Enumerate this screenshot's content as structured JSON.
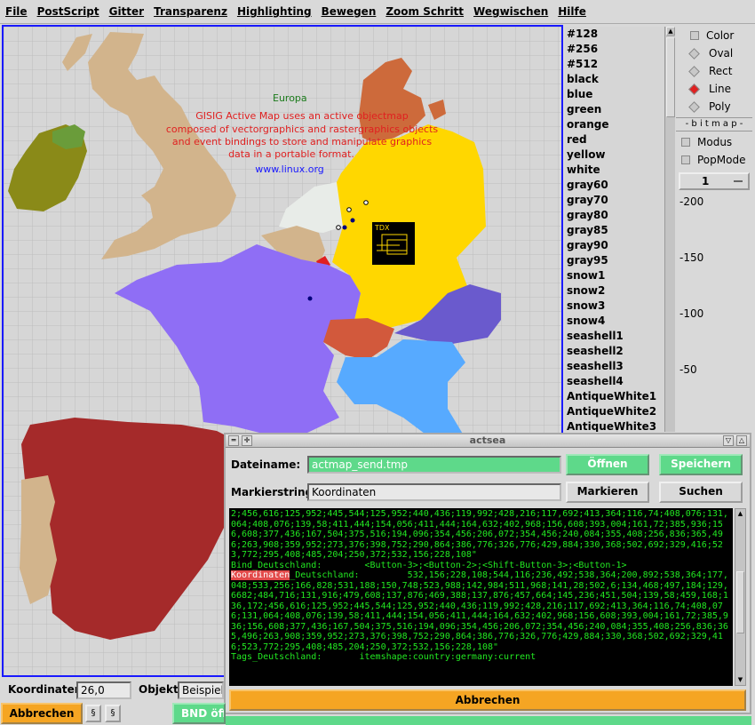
{
  "menu": [
    "File",
    "PostScript",
    "Gitter",
    "Transparenz",
    "Highlighting",
    "Bewegen",
    "Zoom Schritt",
    "Wegwischen",
    "Hilfe"
  ],
  "map": {
    "title": "Europa",
    "description": [
      "GISIG Active Map uses an active objectmap",
      "composed of vectorgraphics and rastergraphics objects",
      "and event bindings to store and manipulate graphics",
      "data in a portable format."
    ],
    "url": "www.linux.org",
    "logo_text": "TDX",
    "colors": {
      "background": "#d6d6d6",
      "grid": "#bdbdbd",
      "germany": "#ffd700",
      "france": "#8f6ef5",
      "spain": "#a52a2a",
      "portugal": "#d2b48c",
      "uk": "#d2b48c",
      "ireland": "#8a8a18",
      "denmark": "#cd6a3b",
      "poland": "#6a5acd",
      "austria": "#d2593c",
      "switzerland_south": "#57aaff",
      "netherlands": "#e8ece8",
      "belgium": "#d2b48c"
    }
  },
  "colorlist": [
    "#128",
    "#256",
    "#512",
    "black",
    "blue",
    "green",
    "orange",
    "red",
    "yellow",
    "white",
    "gray60",
    "gray70",
    "gray80",
    "gray85",
    "gray90",
    "gray95",
    "snow1",
    "snow2",
    "snow3",
    "snow4",
    "seashell1",
    "seashell2",
    "seashell3",
    "seashell4",
    "AntiqueWhite1",
    "AntiqueWhite2",
    "AntiqueWhite3"
  ],
  "rightpanel": {
    "color_label": "Color",
    "shapes": [
      {
        "label": "Oval",
        "selected": false
      },
      {
        "label": "Rect",
        "selected": false
      },
      {
        "label": "Line",
        "selected": true
      },
      {
        "label": "Poly",
        "selected": false
      }
    ],
    "bitmap_label": "- b i t m a p -",
    "modus_label": "Modus",
    "popmode_label": "PopMode",
    "spin_value": "1",
    "ruler": [
      "-200",
      "-150",
      "-100",
      "-50"
    ]
  },
  "dialog": {
    "title": "actsea",
    "filename_label": "Dateiname:",
    "filename_value": "actmap_send.tmp",
    "open_button": "Öffnen",
    "save_button": "Speichern",
    "mark_label": "Markierstring:",
    "mark_value": "Koordinaten",
    "mark_button": "Markieren",
    "search_button": "Suchen",
    "console": {
      "block1": "2;456,616;125,952;445,544;125,952;440,436;119,992;428,216;117,692;413,364;116,74;408,076;131,064;408,076;139,58;411,444;154,056;411,444;164,632;402,968;156,608;393,004;161,72;385,936;156,608;377,436;167,504;375,516;194,096;354,456;206,072;354,456;240,084;355,408;256,836;365,496;263,908;359,952;273,376;398,752;290,864;386,776;326,776;429,884;330,368;502,692;329,416;523,772;295,408;485,204;250,372;532,156;228,108\"",
      "bind_line": "Bind_Deutschland:        <Button-3>;<Button-2>;<Shift-Button-3>;<Button-1>",
      "koord_highlight": "Koordinaten",
      "koord_rest": "_Deutschland:         532,156;228,108;544,116;236,492;538,364;200,892;538,364;177,048;533,256;166,828;531,188;150,748;523,988;142,984;511,968;141,28;502,6;134,468;497,184;129,6682;484,716;131,916;479,608;137,876;469,388;137,876;457,664;145,236;451,504;139,58;459,168;136,172;456,616;125,952;445,544;125,952;440,436;119,992;428,216;117,692;413,364;116,74;408,076;131,064;408,076;139,58;411,444;154,056;411,444;164,632;402,968;156,608;393,004;161,72;385,936;156,608;377,436;167,504;375,516;194,096;354,456;206,072;354,456;240,084;355,408;256,836;365,496;263,908;359,952;273,376;398,752;290,864;386,776;326,776;429,884;330,368;502,692;329,416;523,772;295,408;485,204;250,372;532,156;228,108\"",
      "tags_line": "Tags_Deutschland:       itemshape:country:germany:current"
    },
    "cancel_button": "Abbrechen"
  },
  "bottom": {
    "coord_label": "Koordinaten",
    "coord_value": "26,0",
    "object_label": "Objekt",
    "object_value": "Beispiel",
    "cancel_button": "Abbrechen",
    "bnd_label": "BND öff"
  }
}
